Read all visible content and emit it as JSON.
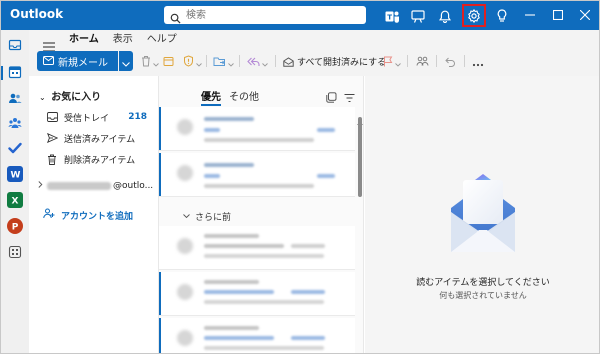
{
  "window": {
    "title": "Outlook"
  },
  "search": {
    "placeholder": "検索"
  },
  "ribbon": {
    "tabs": [
      {
        "label": "ホーム"
      },
      {
        "label": "表示"
      },
      {
        "label": "ヘルプ"
      }
    ],
    "new_mail_label": "新規メール",
    "mark_all_read_label": "すべて開封済みにする"
  },
  "folders": {
    "favorites_label": "お気に入り",
    "items": [
      {
        "label": "受信トレイ",
        "count": "218",
        "icon": "inbox-icon"
      },
      {
        "label": "送信済みアイテム",
        "count": "",
        "icon": "send-icon"
      },
      {
        "label": "削除済みアイテム",
        "count": "",
        "icon": "trash-icon"
      }
    ],
    "account_suffix": "@outlo...",
    "add_account_label": "アカウントを追加"
  },
  "message_list": {
    "tabs": [
      {
        "label": "優先"
      },
      {
        "label": "その他"
      }
    ],
    "group_label": "さらに前"
  },
  "reading_pane": {
    "title": "読むアイテムを選択してください",
    "subtitle": "何も選択されていません"
  },
  "colors": {
    "accent": "#0f6cbd",
    "highlight": "#e02020"
  }
}
